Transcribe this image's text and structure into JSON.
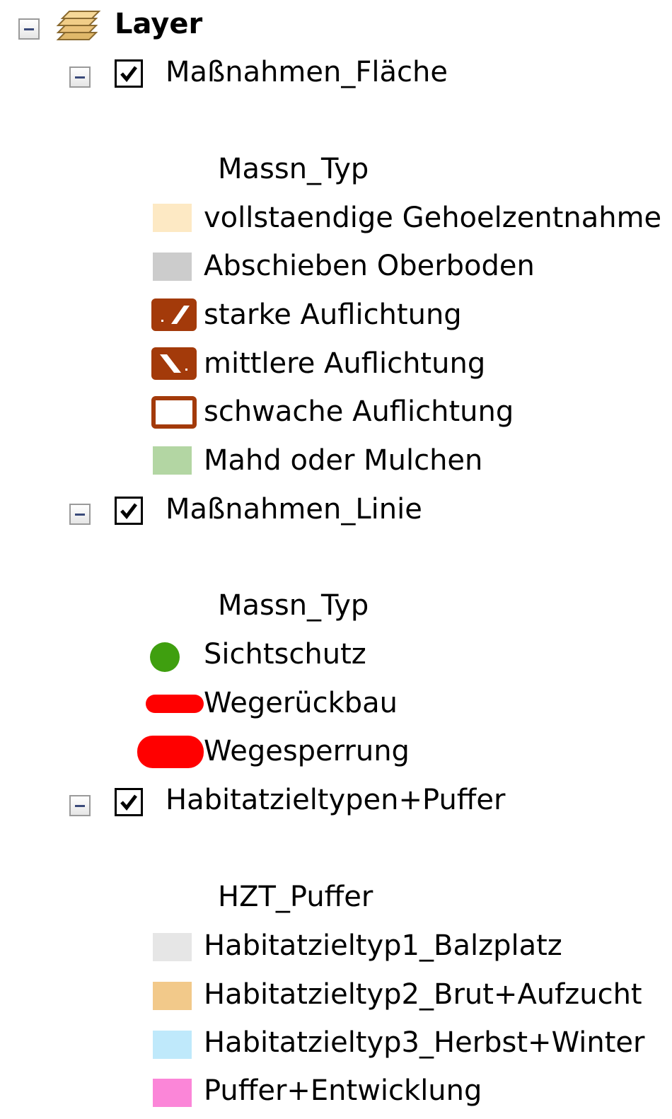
{
  "root": {
    "label": "Layer"
  },
  "layers": [
    {
      "name": "Maßnahmen_Fläche",
      "field": "Massn_Typ",
      "items": [
        {
          "label": "vollstaendige Gehoelzentnahme",
          "symbol": "fill",
          "color": "#fde9c4"
        },
        {
          "label": "Abschieben Oberboden",
          "symbol": "fill",
          "color": "#cccccc"
        },
        {
          "label": "starke Auflichtung",
          "symbol": "hatch-forward",
          "color": "#a33a0a"
        },
        {
          "label": "mittlere Auflichtung",
          "symbol": "hatch-backward",
          "color": "#a33a0a"
        },
        {
          "label": "schwache Auflichtung",
          "symbol": "outline",
          "color": "#a33a0a"
        },
        {
          "label": "Mahd oder Mulchen",
          "symbol": "fill",
          "color": "#b3d6a3"
        }
      ]
    },
    {
      "name": "Maßnahmen_Linie",
      "field": "Massn_Typ",
      "items": [
        {
          "label": "Sichtschutz",
          "symbol": "dot",
          "color": "#3f9f0f"
        },
        {
          "label": "Wegerückbau",
          "symbol": "line-thick",
          "color": "#ff0000"
        },
        {
          "label": "Wegesperrung",
          "symbol": "line-thicker",
          "color": "#ff0000"
        }
      ]
    },
    {
      "name": "Habitatzieltypen+Puffer",
      "field": "HZT_Puffer",
      "items": [
        {
          "label": "Habitatzieltyp1_Balzplatz",
          "symbol": "fill",
          "color": "#e6e6e6"
        },
        {
          "label": "Habitatzieltyp2_Brut+Aufzucht",
          "symbol": "fill",
          "color": "#f2c98a"
        },
        {
          "label": "Habitatzieltyp3_Herbst+Winter",
          "symbol": "fill",
          "color": "#bfe9fb"
        },
        {
          "label": "Puffer+Entwicklung",
          "symbol": "fill",
          "color": "#fb86d8"
        }
      ]
    }
  ]
}
